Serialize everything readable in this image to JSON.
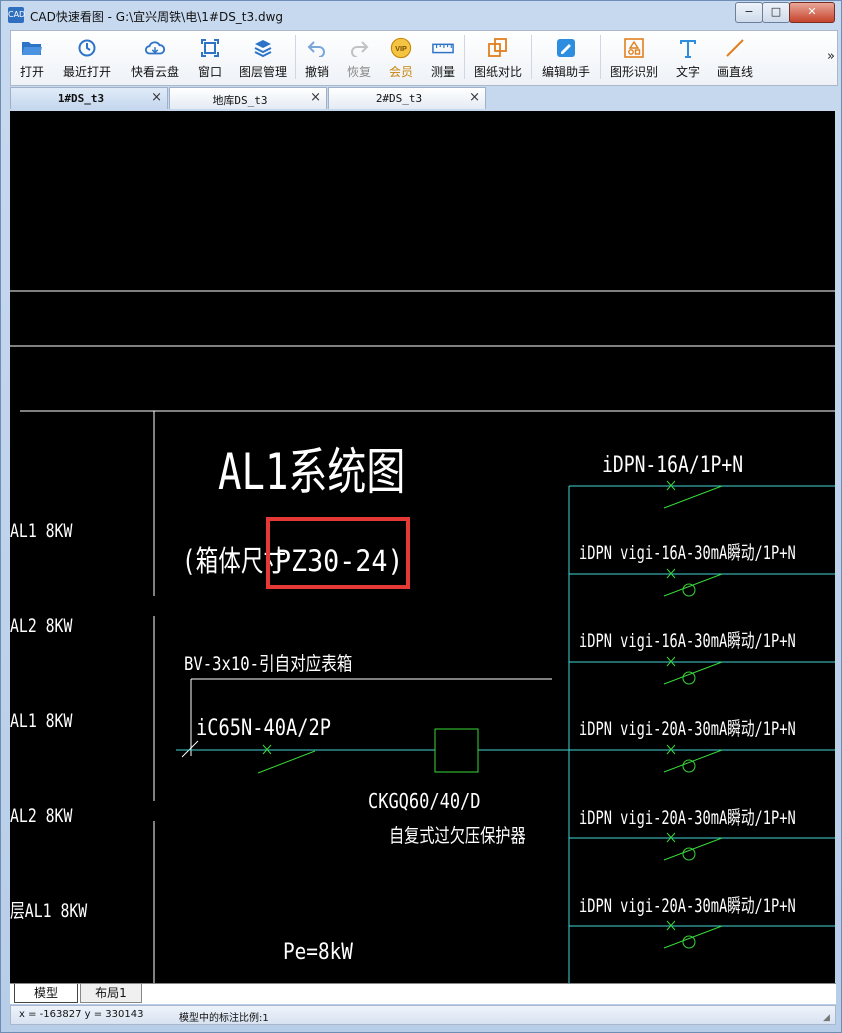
{
  "window": {
    "app_icon_text": "CAD",
    "title": "CAD快速看图 - G:\\宜兴周铁\\电\\1#DS_t3.dwg",
    "minimize_glyph": "−",
    "restore_glyph": "□",
    "close_glyph": "✕"
  },
  "toolbar": {
    "open": "打开",
    "recent": "最近打开",
    "cloud": "快看云盘",
    "window": "窗口",
    "layers": "图层管理",
    "undo": "撤销",
    "redo": "恢复",
    "vip_badge": "VIP",
    "vip": "会员",
    "measure": "测量",
    "compare": "图纸对比",
    "edit_assistant": "编辑助手",
    "shape_recognize": "图形识别",
    "text": "文字",
    "draw_line": "画直线",
    "more": "»"
  },
  "tabs": [
    {
      "label": "1#DS_t3",
      "close": "×"
    },
    {
      "label": "地库DS_t3",
      "close": "×"
    },
    {
      "label": "2#DS_t3",
      "close": "×"
    }
  ],
  "drawing": {
    "title": "AL1系统图",
    "box_label_prefix": "(箱体尺寸",
    "box_label_value": "PZ30-24)",
    "left_labels": [
      "AL1 8KW",
      "AL2 8KW",
      "AL1 8KW",
      "AL2 8KW",
      "层AL1 8KW"
    ],
    "cable": "BV-3x10-引自对应表箱",
    "main_breaker": "iC65N-40A/2P",
    "protector_model": "CKGQ60/40/D",
    "protector_desc": "自复式过欠压保护器",
    "pe": "Pe=8kW",
    "branches": [
      "iDPN-16A/1P+N",
      "iDPN vigi-16A-30mA瞬动/1P+N",
      "iDPN vigi-16A-30mA瞬动/1P+N",
      "iDPN vigi-20A-30mA瞬动/1P+N",
      "iDPN vigi-20A-30mA瞬动/1P+N",
      "iDPN vigi-20A-30mA瞬动/1P+N"
    ],
    "colors": {
      "background": "#000000",
      "white_line": "#ffffff",
      "cyan_line": "#3fd6d6",
      "green_switch": "#38d838",
      "highlight": "#e53935"
    }
  },
  "bottom_tabs": {
    "model": "模型",
    "layout": "布局1"
  },
  "status": {
    "coords": "x = -163827  y = 330143",
    "scale": "模型中的标注比例:1"
  }
}
